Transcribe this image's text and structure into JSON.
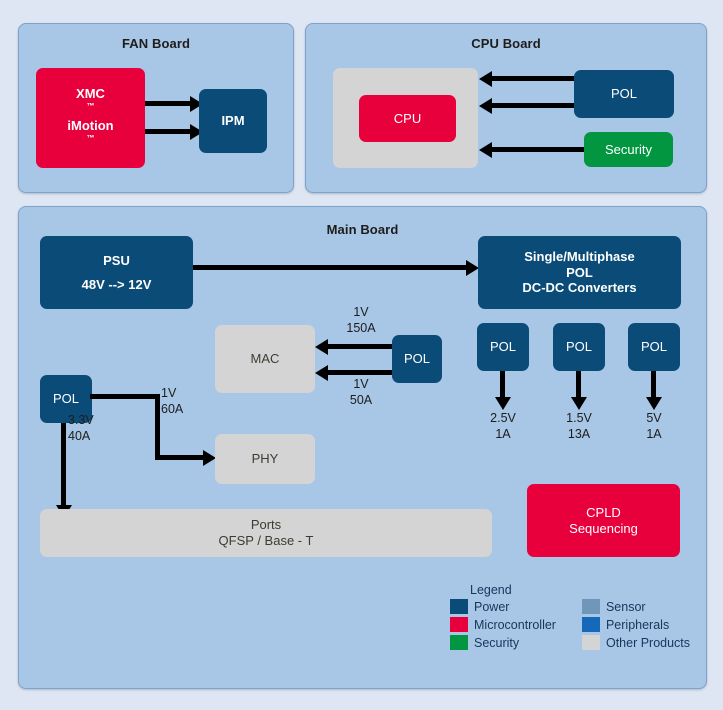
{
  "boards": {
    "fan": {
      "title": "FAN Board",
      "blocks": {
        "xmc": {
          "line1": "XMC",
          "line2": "iMotion",
          "tm": "™",
          "category": "Microcontroller"
        },
        "ipm": {
          "label": "IPM",
          "category": "Power"
        }
      },
      "arrows": [
        "xmc-to-ipm-upper",
        "xmc-to-ipm-lower"
      ]
    },
    "cpu": {
      "title": "CPU Board",
      "blocks": {
        "package": {
          "label": "",
          "category": "Other Products"
        },
        "cpu": {
          "label": "CPU",
          "category": "Microcontroller"
        },
        "pol": {
          "label": "POL",
          "category": "Power"
        },
        "security": {
          "label": "Security",
          "category": "Security"
        }
      },
      "arrows": [
        "pol-to-cpu-upper",
        "pol-to-cpu-lower",
        "security-to-cpu"
      ]
    },
    "main": {
      "title": "Main Board",
      "blocks": {
        "psu": {
          "line1": "PSU",
          "line2": "48V --> 12V",
          "category": "Power"
        },
        "converters": {
          "line1": "Single/Multiphase",
          "line2": "POL",
          "line3": "DC-DC Converters",
          "category": "Power"
        },
        "mac": {
          "label": "MAC",
          "category": "Other Products"
        },
        "phy": {
          "label": "PHY",
          "category": "Other Products"
        },
        "pol_mac": {
          "label": "POL",
          "category": "Power"
        },
        "pol_left": {
          "label": "POL",
          "category": "Power"
        },
        "pol_1": {
          "label": "POL",
          "category": "Power"
        },
        "pol_2": {
          "label": "POL",
          "category": "Power"
        },
        "pol_3": {
          "label": "POL",
          "category": "Power"
        },
        "ports": {
          "line1": "Ports",
          "line2": "QFSP / Base - T",
          "category": "Other Products"
        },
        "cpld": {
          "line1": "CPLD",
          "line2": "Sequencing",
          "category": "Microcontroller"
        }
      },
      "rail_labels": {
        "mac_upper": "1V\n150A",
        "mac_lower": "1V\n50A",
        "phy": "1V\n60A",
        "ports": "3.3V\n40A",
        "pol_1_out": "2.5V\n1A",
        "pol_2_out": "1.5V\n13A",
        "pol_3_out": "5V\n1A"
      }
    }
  },
  "legend": {
    "title": "Legend",
    "columns": [
      [
        {
          "label": "Power",
          "color": "#0a4b78"
        },
        {
          "label": "Microcontroller",
          "color": "#e8003c"
        },
        {
          "label": "Security",
          "color": "#029640"
        }
      ],
      [
        {
          "label": "Sensor",
          "color": "#7096b8"
        },
        {
          "label": "Peripherals",
          "color": "#1668b8"
        },
        {
          "label": "Other Products",
          "color": "#d4d4d4"
        }
      ]
    ]
  },
  "palette": {
    "page_background": "#dfe6f3",
    "panel_background": "#a8c6e6",
    "panel_border": "#7ea3cc",
    "connector": "#000000"
  }
}
